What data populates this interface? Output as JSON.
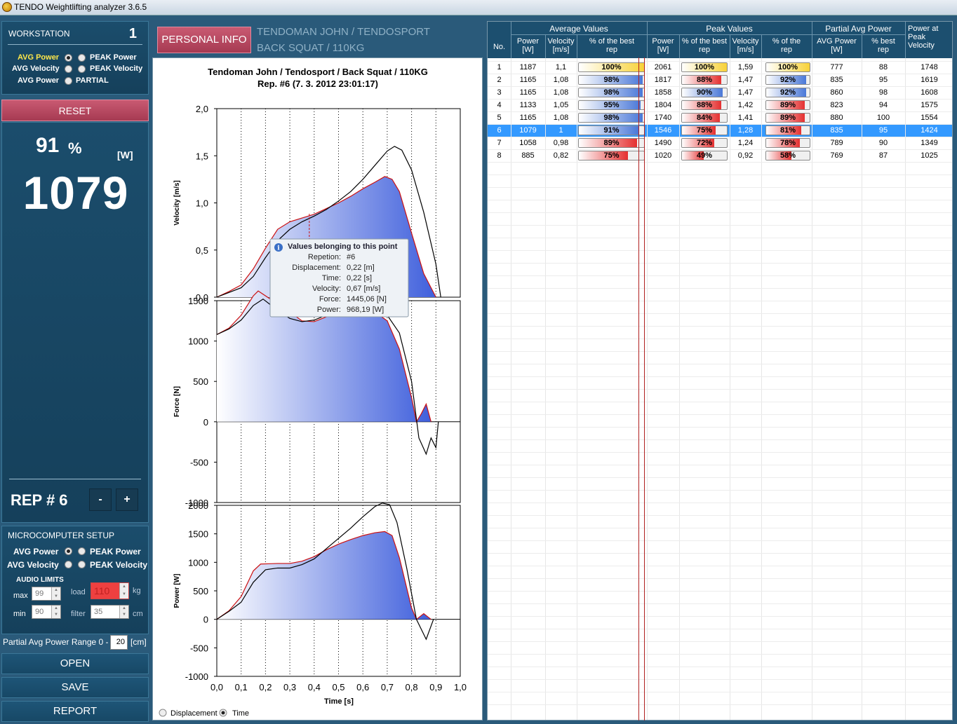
{
  "window": {
    "title": "TENDO Weightlifting analyzer 3.6.5"
  },
  "workstation": {
    "label": "WORKSTATION",
    "number": "1",
    "options": [
      {
        "label": "AVG Power",
        "selected": true
      },
      {
        "label": "PEAK Power",
        "selected": false
      },
      {
        "label": "AVG Velocity",
        "selected": false
      },
      {
        "label": "PEAK Velocity",
        "selected": false
      },
      {
        "label": "AVG Power",
        "selected": false
      },
      {
        "label": "PARTIAL",
        "selected": false
      }
    ]
  },
  "reset_label": "RESET",
  "display": {
    "percent": "91",
    "percent_sign": "%",
    "unit": "[W]",
    "value": "1079"
  },
  "rep": {
    "label": "REP # 6",
    "minus": "-",
    "plus": "+"
  },
  "microcomputer": {
    "title": "MICROCOMPUTER SETUP",
    "options": [
      {
        "label": "AVG Power",
        "selected": true
      },
      {
        "label": "PEAK Power",
        "selected": false
      },
      {
        "label": "AVG Velocity",
        "selected": false
      },
      {
        "label": "PEAK Velocity",
        "selected": false
      }
    ],
    "audio_limits": "AUDIO LIMITS",
    "max_label": "max",
    "max_value": "99",
    "min_label": "min",
    "min_value": "90",
    "load_label": "load",
    "load_value": "110",
    "load_unit": "kg",
    "filter_label": "filter",
    "filter_value": "35",
    "filter_unit": "cm"
  },
  "partial": {
    "label": "Partial Avg Power Range  0 -",
    "value": "20",
    "unit": "[cm]"
  },
  "actions": {
    "open": "OPEN",
    "save": "SAVE",
    "report": "REPORT"
  },
  "personal": {
    "button": "PERSONAL INFO",
    "line1": "TENDOMAN JOHN / TENDOSPORT",
    "line2": "BACK SQUAT /  110KG"
  },
  "chart_header": {
    "title": "Tendoman John / Tendosport / Back Squat /  110KG",
    "subtitle": "Rep. #6    (7. 3. 2012 23:01:17)"
  },
  "tooltip": {
    "title": "Values belonging to this point",
    "rows": [
      {
        "label": "Repetion:",
        "value": "#6"
      },
      {
        "label": "Displacement:",
        "value": "0,22   [m]"
      },
      {
        "label": "Time:",
        "value": "0,22   [s]"
      },
      {
        "label": "Velocity:",
        "value": "0,67   [m/s]"
      },
      {
        "label": "Force:",
        "value": "1445,06   [N]"
      },
      {
        "label": "Power:",
        "value": "968,19   [W]"
      }
    ]
  },
  "x_axis_mode": {
    "displacement": "Displacement",
    "time": "Time",
    "selected": "time"
  },
  "chart_data": [
    {
      "type": "area",
      "ylabel": "Velocity [m/s]",
      "xlim": [
        0,
        1.0
      ],
      "ylim": [
        0,
        2.0
      ],
      "yticks": [
        "0,0",
        "0,5",
        "1,0",
        "1,5",
        "2,0"
      ],
      "series": [
        {
          "x": [
            0,
            0.05,
            0.1,
            0.15,
            0.2,
            0.25,
            0.3,
            0.4,
            0.45,
            0.5,
            0.55,
            0.6,
            0.65,
            0.69,
            0.72,
            0.75,
            0.8,
            0.85,
            0.9
          ],
          "y": [
            0,
            0.06,
            0.13,
            0.3,
            0.52,
            0.72,
            0.8,
            0.88,
            0.94,
            1.0,
            1.07,
            1.15,
            1.22,
            1.28,
            1.25,
            1.12,
            0.68,
            0.25,
            0
          ]
        },
        {
          "x": [
            0,
            0.05,
            0.1,
            0.15,
            0.2,
            0.25,
            0.3,
            0.35,
            0.4,
            0.45,
            0.5,
            0.55,
            0.6,
            0.65,
            0.7,
            0.73,
            0.76,
            0.8,
            0.85,
            0.9,
            0.92
          ],
          "y": [
            0,
            0.05,
            0.1,
            0.22,
            0.42,
            0.6,
            0.72,
            0.8,
            0.86,
            0.93,
            1.02,
            1.12,
            1.25,
            1.4,
            1.55,
            1.6,
            1.56,
            1.35,
            0.9,
            0.35,
            0
          ]
        }
      ]
    },
    {
      "type": "area",
      "ylabel": "Force [N]",
      "xlim": [
        0,
        1.0
      ],
      "ylim": [
        -1000,
        1500
      ],
      "yticks": [
        "1500",
        "1000",
        "500",
        "0",
        "-500",
        "-1000"
      ],
      "series": [
        {
          "x": [
            0,
            0.05,
            0.1,
            0.15,
            0.17,
            0.22,
            0.3,
            0.35,
            0.4,
            0.45,
            0.5,
            0.55,
            0.6,
            0.65,
            0.7,
            0.75,
            0.8,
            0.82,
            0.84,
            0.86,
            0.88
          ],
          "y": [
            1080,
            1160,
            1320,
            1560,
            1620,
            1520,
            1360,
            1250,
            1240,
            1300,
            1360,
            1380,
            1380,
            1360,
            1250,
            900,
            300,
            0,
            100,
            220,
            0
          ]
        },
        {
          "x": [
            0,
            0.05,
            0.1,
            0.15,
            0.19,
            0.25,
            0.3,
            0.35,
            0.4,
            0.45,
            0.5,
            0.55,
            0.6,
            0.65,
            0.7,
            0.75,
            0.8,
            0.83,
            0.86,
            0.88,
            0.9,
            0.91
          ],
          "y": [
            1080,
            1150,
            1260,
            1440,
            1520,
            1380,
            1280,
            1240,
            1260,
            1320,
            1380,
            1420,
            1420,
            1400,
            1320,
            1100,
            500,
            -200,
            -400,
            -200,
            -320,
            0
          ]
        }
      ]
    },
    {
      "type": "area",
      "ylabel": "Power [W]",
      "xlim": [
        0,
        1.0
      ],
      "ylim": [
        -1000,
        2000
      ],
      "yticks": [
        "2000",
        "1500",
        "1000",
        "500",
        "0",
        "-500",
        "-1000"
      ],
      "series": [
        {
          "x": [
            0,
            0.05,
            0.1,
            0.15,
            0.18,
            0.25,
            0.3,
            0.35,
            0.4,
            0.45,
            0.5,
            0.55,
            0.6,
            0.65,
            0.69,
            0.72,
            0.75,
            0.8,
            0.82,
            0.85,
            0.88
          ],
          "y": [
            0,
            150,
            400,
            850,
            970,
            980,
            980,
            1020,
            1100,
            1220,
            1320,
            1400,
            1470,
            1520,
            1540,
            1470,
            1080,
            200,
            0,
            100,
            0
          ]
        },
        {
          "x": [
            0,
            0.05,
            0.1,
            0.15,
            0.2,
            0.25,
            0.3,
            0.35,
            0.4,
            0.45,
            0.5,
            0.55,
            0.6,
            0.65,
            0.68,
            0.71,
            0.74,
            0.78,
            0.82,
            0.86,
            0.89
          ],
          "y": [
            0,
            140,
            300,
            650,
            870,
            900,
            900,
            960,
            1060,
            1240,
            1420,
            1600,
            1800,
            1980,
            2040,
            2010,
            1700,
            900,
            0,
            -350,
            0
          ]
        }
      ]
    }
  ],
  "chart_xaxis": {
    "label": "Time [s]",
    "ticks": [
      "0,0",
      "0,1",
      "0,2",
      "0,3",
      "0,4",
      "0,5",
      "0,6",
      "0,7",
      "0,8",
      "0,9",
      "1,0"
    ]
  },
  "table": {
    "groups": [
      "Average Values",
      "Peak Values",
      "Partial Avg Power",
      "Power at Peak Velocity"
    ],
    "columns": [
      "No.",
      "Power [W]",
      "Velocity [m/s]",
      "% of the best rep",
      "Power [W]",
      "% of the best rep",
      "Velocity [m/s]",
      "% of the rep",
      "AVG Power [W]",
      "% best rep"
    ],
    "col_heads": [
      [
        "No."
      ],
      [
        "Power",
        "[W]"
      ],
      [
        "Velocity",
        "[m/s]"
      ],
      [
        "% of the best",
        "rep"
      ],
      [
        "Power",
        "[W]"
      ],
      [
        "% of the best",
        "rep"
      ],
      [
        "Velocity",
        "[m/s]"
      ],
      [
        "% of the",
        "rep"
      ],
      [
        "AVG Power",
        "[W]"
      ],
      [
        "%  best",
        "rep"
      ],
      [
        "Power at",
        "Peak",
        "Velocity"
      ]
    ],
    "rows": [
      {
        "no": "1",
        "avg_power": "1187",
        "avg_vel": "1,1",
        "avg_pct": "100%",
        "avg_pct_v": 100,
        "peak_power": "2061",
        "peak_pct": "100%",
        "peak_pct_v": 100,
        "peak_vel": "1,59",
        "vel_pct": "100%",
        "vel_pct_v": 100,
        "part_power": "777",
        "part_pct": "88",
        "ppv": "1748"
      },
      {
        "no": "2",
        "avg_power": "1165",
        "avg_vel": "1,08",
        "avg_pct": "98%",
        "avg_pct_v": 98,
        "peak_power": "1817",
        "peak_pct": "88%",
        "peak_pct_v": 88,
        "peak_vel": "1,47",
        "vel_pct": "92%",
        "vel_pct_v": 92,
        "part_power": "835",
        "part_pct": "95",
        "ppv": "1619"
      },
      {
        "no": "3",
        "avg_power": "1165",
        "avg_vel": "1,08",
        "avg_pct": "98%",
        "avg_pct_v": 98,
        "peak_power": "1858",
        "peak_pct": "90%",
        "peak_pct_v": 90,
        "peak_vel": "1,47",
        "vel_pct": "92%",
        "vel_pct_v": 92,
        "part_power": "860",
        "part_pct": "98",
        "ppv": "1608"
      },
      {
        "no": "4",
        "avg_power": "1133",
        "avg_vel": "1,05",
        "avg_pct": "95%",
        "avg_pct_v": 95,
        "peak_power": "1804",
        "peak_pct": "88%",
        "peak_pct_v": 88,
        "peak_vel": "1,42",
        "vel_pct": "89%",
        "vel_pct_v": 89,
        "part_power": "823",
        "part_pct": "94",
        "ppv": "1575"
      },
      {
        "no": "5",
        "avg_power": "1165",
        "avg_vel": "1,08",
        "avg_pct": "98%",
        "avg_pct_v": 98,
        "peak_power": "1740",
        "peak_pct": "84%",
        "peak_pct_v": 84,
        "peak_vel": "1,41",
        "vel_pct": "89%",
        "vel_pct_v": 89,
        "part_power": "880",
        "part_pct": "100",
        "ppv": "1554"
      },
      {
        "no": "6",
        "avg_power": "1079",
        "avg_vel": "1",
        "avg_pct": "91%",
        "avg_pct_v": 91,
        "peak_power": "1546",
        "peak_pct": "75%",
        "peak_pct_v": 75,
        "peak_vel": "1,28",
        "vel_pct": "81%",
        "vel_pct_v": 81,
        "part_power": "835",
        "part_pct": "95",
        "ppv": "1424",
        "selected": true
      },
      {
        "no": "7",
        "avg_power": "1058",
        "avg_vel": "0,98",
        "avg_pct": "89%",
        "avg_pct_v": 89,
        "peak_power": "1490",
        "peak_pct": "72%",
        "peak_pct_v": 72,
        "peak_vel": "1,24",
        "vel_pct": "78%",
        "vel_pct_v": 78,
        "part_power": "789",
        "part_pct": "90",
        "ppv": "1349"
      },
      {
        "no": "8",
        "avg_power": "885",
        "avg_vel": "0,82",
        "avg_pct": "75%",
        "avg_pct_v": 75,
        "peak_power": "1020",
        "peak_pct": "49%",
        "peak_pct_v": 49,
        "peak_vel": "0,92",
        "vel_pct": "58%",
        "vel_pct_v": 58,
        "part_power": "769",
        "part_pct": "87",
        "ppv": "1025"
      }
    ]
  },
  "colors": {
    "panel": "#1b4d6c",
    "accent_pink": "#b8475f",
    "best_bar": "#f8d238",
    "good_bar": "#4a78d8",
    "low_bar": "#e53030",
    "selected_row": "#3399ff",
    "curve_fill": "#4a6ee0",
    "curve_edge": "#cc1010"
  }
}
